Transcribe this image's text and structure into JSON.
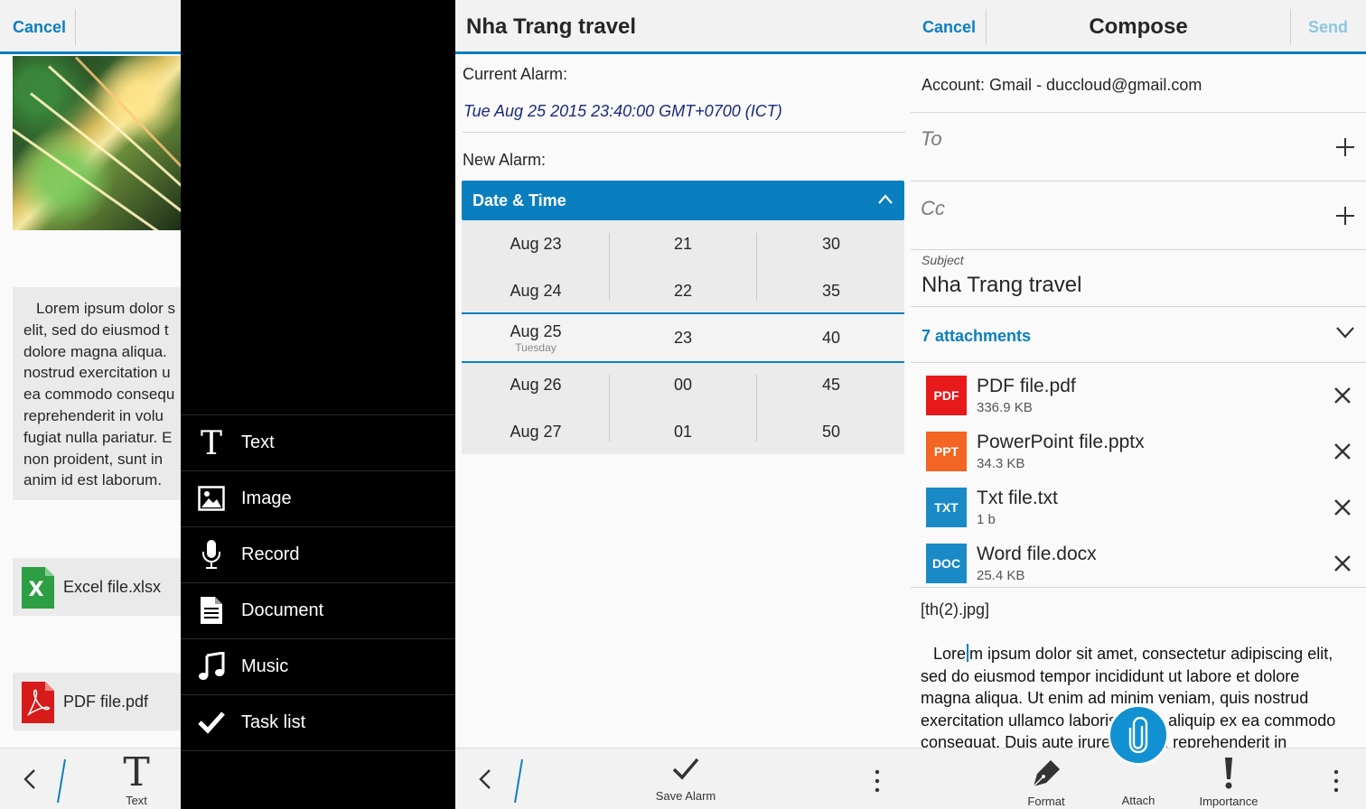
{
  "note": {
    "cancel_label": "Cancel",
    "paragraph_lines": [
      "Lorem ipsum dolor s",
      "elit, sed do eiusmod t",
      "dolore magna aliqua.",
      "nostrud exercitation u",
      "ea commodo consequ",
      "reprehenderit in volu",
      "fugiat nulla pariatur. E",
      "non proident, sunt in",
      "anim id est laborum."
    ],
    "attachments": [
      {
        "name": "Excel file.xlsx"
      },
      {
        "name": "PDF file.pdf"
      }
    ],
    "toolbar": {
      "text_label": "Text",
      "text_glyph": "T"
    }
  },
  "attach_menu": {
    "items": [
      {
        "label": "Text",
        "icon": "text-icon"
      },
      {
        "label": "Image",
        "icon": "image-icon"
      },
      {
        "label": "Record",
        "icon": "microphone-icon"
      },
      {
        "label": "Document",
        "icon": "document-icon"
      },
      {
        "label": "Music",
        "icon": "music-icon"
      },
      {
        "label": "Task list",
        "icon": "checkmark-icon"
      }
    ]
  },
  "alarm": {
    "title": "Nha Trang travel",
    "current_label": "Current Alarm:",
    "current_value": "Tue Aug 25 2015 23:40:00 GMT+0700 (ICT)",
    "new_label": "New Alarm:",
    "picker_header": "Date & Time",
    "picker": {
      "dates": [
        "Aug 23",
        "Aug 24",
        "Aug 25",
        "Aug 26",
        "Aug 27"
      ],
      "selected_weekday": "Tuesday",
      "hours": [
        "21",
        "22",
        "23",
        "00",
        "01"
      ],
      "minutes": [
        "30",
        "35",
        "40",
        "45",
        "50"
      ]
    },
    "save_label": "Save Alarm"
  },
  "compose": {
    "cancel_label": "Cancel",
    "title": "Compose",
    "send_label": "Send",
    "account": "Account: Gmail - duccloud@gmail.com",
    "to_placeholder": "To",
    "cc_placeholder": "Cc",
    "subject_label": "Subject",
    "subject": "Nha Trang travel",
    "attachments_count": "7 attachments",
    "attachments": [
      {
        "badge": "PDF",
        "name": "PDF file.pdf",
        "size": "336.9 KB",
        "color": "#e8191b"
      },
      {
        "badge": "PPT",
        "name": "PowerPoint file.pptx",
        "size": "34.3 KB",
        "color": "#f26522"
      },
      {
        "badge": "TXT",
        "name": "Txt file.txt",
        "size": "1 b",
        "color": "#1a8ac7"
      },
      {
        "badge": "DOC",
        "name": "Word file.docx",
        "size": "25.4 KB",
        "color": "#1a8ac7"
      }
    ],
    "image_ref": "[th(2).jpg]",
    "body_first_a": "Lore",
    "body_first_b": "m ipsum dolor sit amet, consectetur adipiscing elit,",
    "body_lines": [
      "sed do eiusmod tempor incididunt ut labore et dolore",
      "magna aliqua. Ut enim ad minim veniam, quis nostrud",
      "exercitation ullamco laboris nisi ut aliquip ex ea commodo",
      "consequat. Duis aute irure dolor in reprehenderit in"
    ],
    "actions": {
      "format": "Format",
      "attach": "Attach",
      "importance": "Importance"
    }
  },
  "colors": {
    "accent": "#0a7fc0",
    "send_disabled": "#8ec6e4",
    "fab": "#1191d2"
  }
}
